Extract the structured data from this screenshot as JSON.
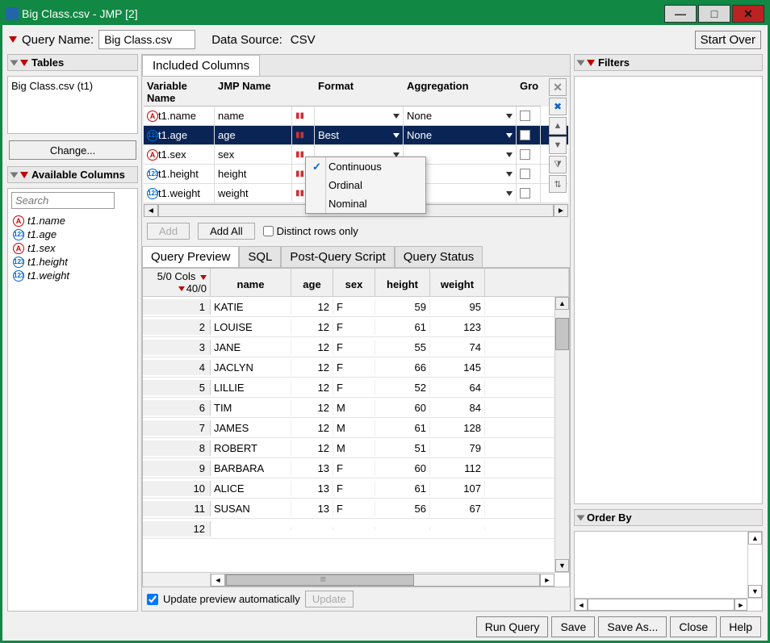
{
  "window": {
    "title": "Big Class.csv - JMP [2]"
  },
  "win_buttons": {
    "min": "—",
    "max": "□",
    "close": "✕"
  },
  "topbar": {
    "query_name_label": "Query Name:",
    "query_name_value": "Big Class.csv",
    "data_source_label": "Data Source:",
    "data_source_value": "CSV",
    "start_over": "Start Over"
  },
  "tables": {
    "heading": "Tables",
    "item": "Big Class.csv (t1)",
    "change": "Change..."
  },
  "available": {
    "heading": "Available Columns",
    "search_placeholder": "Search",
    "items": [
      {
        "name": "t1.name",
        "type": "A"
      },
      {
        "name": "t1.age",
        "type": "123"
      },
      {
        "name": "t1.sex",
        "type": "A"
      },
      {
        "name": "t1.height",
        "type": "123"
      },
      {
        "name": "t1.weight",
        "type": "123"
      }
    ]
  },
  "included": {
    "tab_label": "Included Columns",
    "headers": {
      "var": "Variable Name",
      "jmp": "JMP Name",
      "format": "Format",
      "agg": "Aggregation",
      "group": "Gro"
    },
    "rows": [
      {
        "var": "t1.name",
        "jmp": "name",
        "type": "A",
        "fmt": "",
        "agg": "None",
        "selected": false
      },
      {
        "var": "t1.age",
        "jmp": "age",
        "type": "123",
        "fmt": "Best",
        "agg": "None",
        "selected": true
      },
      {
        "var": "t1.sex",
        "jmp": "sex",
        "type": "A",
        "fmt": "",
        "agg": "",
        "selected": false
      },
      {
        "var": "t1.height",
        "jmp": "height",
        "type": "123",
        "fmt": "",
        "agg": "",
        "selected": false
      },
      {
        "var": "t1.weight",
        "jmp": "weight",
        "type": "123",
        "fmt": "",
        "agg": "",
        "selected": false
      }
    ],
    "add": "Add",
    "add_all": "Add All",
    "distinct": "Distinct rows only"
  },
  "context_menu": {
    "items": [
      "Continuous",
      "Ordinal",
      "Nominal"
    ],
    "checked": 0
  },
  "preview": {
    "tabs": [
      "Query Preview",
      "SQL",
      "Post-Query Script",
      "Query Status"
    ],
    "active_tab": 0,
    "cols_info": "5/0 Cols",
    "rows_info": "40/0",
    "headers": [
      "name",
      "age",
      "sex",
      "height",
      "weight"
    ],
    "rows": [
      {
        "n": 1,
        "name": "KATIE",
        "age": 12,
        "sex": "F",
        "height": 59,
        "weight": 95
      },
      {
        "n": 2,
        "name": "LOUISE",
        "age": 12,
        "sex": "F",
        "height": 61,
        "weight": 123
      },
      {
        "n": 3,
        "name": "JANE",
        "age": 12,
        "sex": "F",
        "height": 55,
        "weight": 74
      },
      {
        "n": 4,
        "name": "JACLYN",
        "age": 12,
        "sex": "F",
        "height": 66,
        "weight": 145
      },
      {
        "n": 5,
        "name": "LILLIE",
        "age": 12,
        "sex": "F",
        "height": 52,
        "weight": 64
      },
      {
        "n": 6,
        "name": "TIM",
        "age": 12,
        "sex": "M",
        "height": 60,
        "weight": 84
      },
      {
        "n": 7,
        "name": "JAMES",
        "age": 12,
        "sex": "M",
        "height": 61,
        "weight": 128
      },
      {
        "n": 8,
        "name": "ROBERT",
        "age": 12,
        "sex": "M",
        "height": 51,
        "weight": 79
      },
      {
        "n": 9,
        "name": "BARBARA",
        "age": 13,
        "sex": "F",
        "height": 60,
        "weight": 112
      },
      {
        "n": 10,
        "name": "ALICE",
        "age": 13,
        "sex": "F",
        "height": 61,
        "weight": 107
      },
      {
        "n": 11,
        "name": "SUSAN",
        "age": 13,
        "sex": "F",
        "height": 56,
        "weight": 67
      },
      {
        "n": 12,
        "name": "",
        "age": "",
        "sex": "",
        "height": "",
        "weight": ""
      }
    ],
    "update_auto": "Update preview automatically",
    "update_btn": "Update"
  },
  "filters": {
    "heading": "Filters"
  },
  "order_by": {
    "heading": "Order By"
  },
  "buttons": {
    "run": "Run Query",
    "save": "Save",
    "save_as": "Save As...",
    "close": "Close",
    "help": "Help"
  }
}
